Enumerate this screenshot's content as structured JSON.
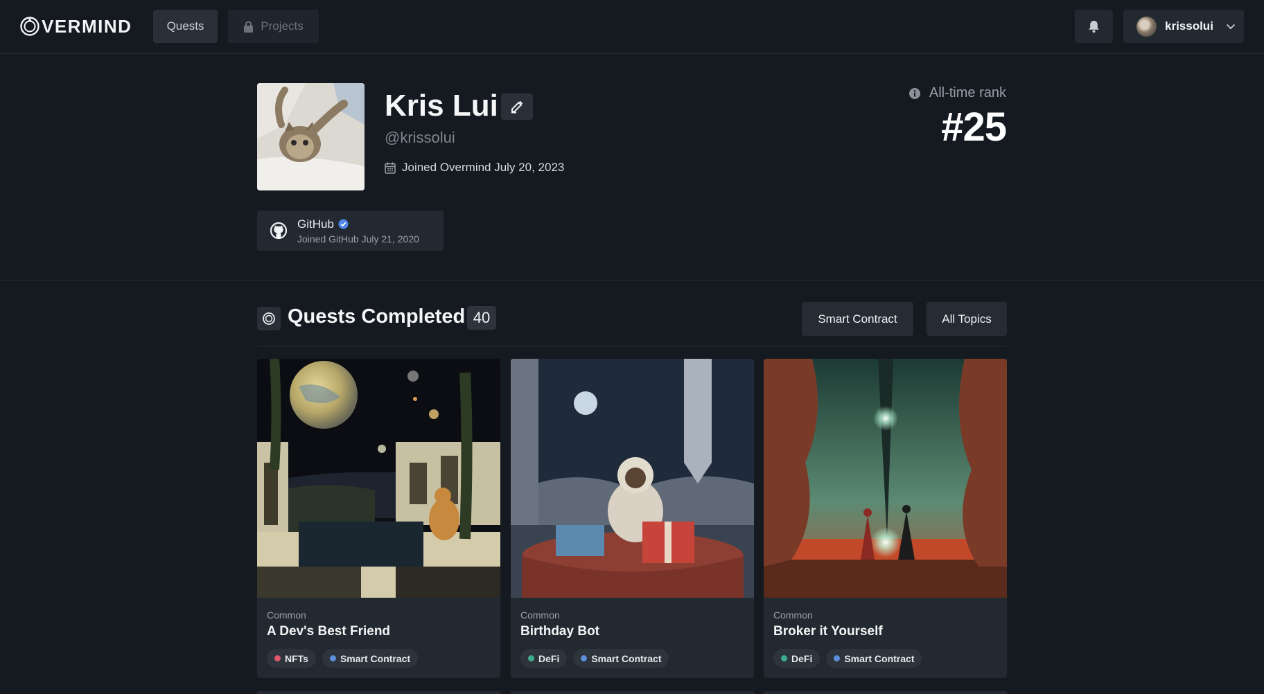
{
  "nav": {
    "logo_text": "VERMIND",
    "quests_label": "Quests",
    "projects_label": "Projects",
    "username": "krissolui"
  },
  "profile": {
    "name": "Kris Lui",
    "handle": "@krissolui",
    "joined": "Joined Overmind July 20, 2023",
    "rank_label": "All-time rank",
    "rank_value": "#25",
    "github": {
      "title": "GitHub",
      "subtitle": "Joined GitHub July 21, 2020"
    }
  },
  "quests_section": {
    "title": "Quests Completed",
    "count": "40",
    "filters": [
      "Smart Contract",
      "All Topics"
    ]
  },
  "cards": [
    {
      "rarity": "Common",
      "title": "A Dev's Best Friend",
      "tags": [
        {
          "label": "NFTs",
          "color": "#e0576b"
        },
        {
          "label": "Smart Contract",
          "color": "#5b8fd9"
        }
      ]
    },
    {
      "rarity": "Common",
      "title": "Birthday Bot",
      "tags": [
        {
          "label": "DeFi",
          "color": "#3fae8f"
        },
        {
          "label": "Smart Contract",
          "color": "#5b8fd9"
        }
      ]
    },
    {
      "rarity": "Common",
      "title": "Broker it Yourself",
      "tags": [
        {
          "label": "DeFi",
          "color": "#3fae8f"
        },
        {
          "label": "Smart Contract",
          "color": "#5b8fd9"
        }
      ]
    }
  ],
  "colors": {
    "background": "#151a20",
    "surface": "#232930",
    "verified": "#4f86e8"
  }
}
